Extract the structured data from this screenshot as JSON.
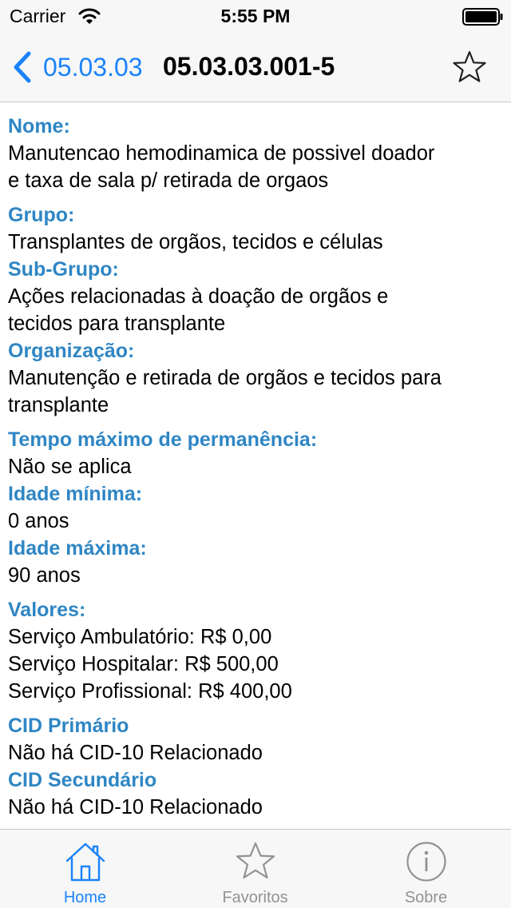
{
  "status_bar": {
    "carrier": "Carrier",
    "time": "5:55 PM"
  },
  "nav": {
    "back_label": "05.03.03",
    "title": "05.03.03.001-5",
    "favorite_icon": "star-outline-icon"
  },
  "details": {
    "nome": {
      "label": "Nome:",
      "lines": [
        "Manutencao hemodinamica de possivel doador",
        "e taxa de sala p/ retirada de orgaos"
      ]
    },
    "grupo": {
      "label": "Grupo:",
      "lines": [
        "Transplantes de orgãos, tecidos e células"
      ]
    },
    "subgrupo": {
      "label": "Sub-Grupo:",
      "lines": [
        "Ações relacionadas à doação de orgãos e",
        "tecidos para transplante"
      ]
    },
    "organizacao": {
      "label": "Organização:",
      "lines": [
        "Manutenção e retirada de orgãos e tecidos para",
        "transplante"
      ]
    },
    "tempo": {
      "label": "Tempo máximo de permanência:",
      "lines": [
        "Não se aplica"
      ]
    },
    "idade_min": {
      "label": "Idade mínima:",
      "lines": [
        "0 anos"
      ]
    },
    "idade_max": {
      "label": "Idade máxima:",
      "lines": [
        "90 anos"
      ]
    },
    "valores": {
      "label": "Valores:",
      "lines": [
        "Serviço Ambulatório: R$ 0,00",
        "Serviço Hospitalar: R$ 500,00",
        "Serviço Profissional: R$ 400,00"
      ]
    },
    "cid_primario": {
      "label": "CID Primário",
      "lines": [
        "Não há CID-10 Relacionado"
      ]
    },
    "cid_secundario": {
      "label": "CID Secundário",
      "lines": [
        "Não há CID-10 Relacionado"
      ]
    }
  },
  "tabs": [
    {
      "label": "Home",
      "icon": "home-icon",
      "active": true
    },
    {
      "label": "Favoritos",
      "icon": "star-icon",
      "active": false
    },
    {
      "label": "Sobre",
      "icon": "info-icon",
      "active": false
    }
  ],
  "colors": {
    "tint": "#1a82fb",
    "label_blue": "#2f86c4",
    "inactive_gray": "#929292",
    "bar_background": "#f7f7f8"
  }
}
